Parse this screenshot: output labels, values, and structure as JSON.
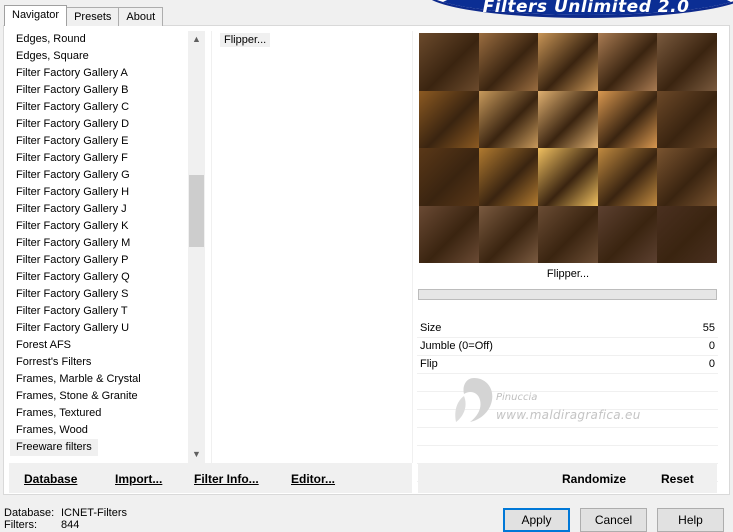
{
  "banner": {
    "title": "Filters Unlimited 2.0"
  },
  "tabs": [
    "Navigator",
    "Presets",
    "About"
  ],
  "categories": {
    "items": [
      "Edges, Round",
      "Edges, Square",
      "Filter Factory Gallery A",
      "Filter Factory Gallery B",
      "Filter Factory Gallery C",
      "Filter Factory Gallery D",
      "Filter Factory Gallery E",
      "Filter Factory Gallery F",
      "Filter Factory Gallery G",
      "Filter Factory Gallery H",
      "Filter Factory Gallery J",
      "Filter Factory Gallery K",
      "Filter Factory Gallery M",
      "Filter Factory Gallery P",
      "Filter Factory Gallery Q",
      "Filter Factory Gallery S",
      "Filter Factory Gallery T",
      "Filter Factory Gallery U",
      "Forest AFS",
      "Forrest's Filters",
      "Frames, Marble & Crystal",
      "Frames, Stone & Granite",
      "Frames, Textured",
      "Frames, Wood",
      "Freeware filters"
    ],
    "selected": "Freeware filters"
  },
  "filters": {
    "selected": "Flipper..."
  },
  "preview": {
    "label": "Flipper..."
  },
  "params": [
    {
      "name": "Size",
      "value": "55"
    },
    {
      "name": "Jumble (0=Off)",
      "value": "0"
    },
    {
      "name": "Flip",
      "value": "0"
    }
  ],
  "watermark": {
    "name": "Pinuccia",
    "url": "www.maldiragrafica.eu"
  },
  "left_buttons": {
    "database": "Database",
    "import": "Import...",
    "filter_info": "Filter Info...",
    "editor": "Editor..."
  },
  "right_buttons": {
    "randomize": "Randomize",
    "reset": "Reset"
  },
  "status": {
    "database_label": "Database:",
    "database_value": "ICNET-Filters",
    "filters_label": "Filters:",
    "filters_value": "844"
  },
  "dialog_buttons": {
    "apply": "Apply",
    "cancel": "Cancel",
    "help": "Help"
  },
  "colors": {
    "banner_blue": "#0b2e94",
    "accent_blue": "#0078d7"
  }
}
